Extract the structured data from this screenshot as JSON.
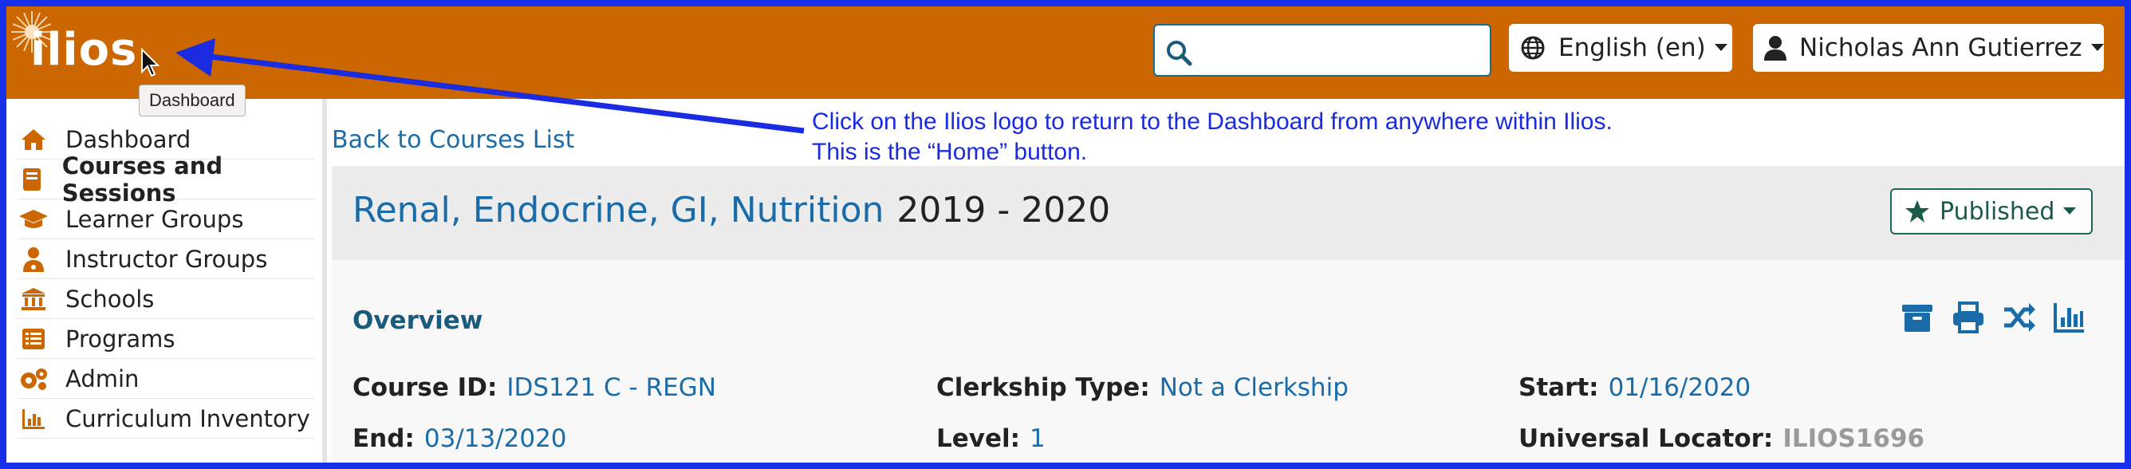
{
  "header": {
    "logo_text": "ilios",
    "tooltip": "Dashboard",
    "search": {
      "value": "",
      "placeholder": ""
    },
    "language": "English (en)",
    "user": "Nicholas Ann Gutierrez",
    "accent_color": "#cc6600"
  },
  "sidebar": {
    "items": [
      {
        "label": "Dashboard",
        "icon": "home-icon",
        "active": false
      },
      {
        "label": "Courses and Sessions",
        "icon": "book-icon",
        "active": true
      },
      {
        "label": "Learner Groups",
        "icon": "graduation-cap-icon",
        "active": false
      },
      {
        "label": "Instructor Groups",
        "icon": "user-md-icon",
        "active": false
      },
      {
        "label": "Schools",
        "icon": "university-icon",
        "active": false
      },
      {
        "label": "Programs",
        "icon": "list-alt-icon",
        "active": false
      },
      {
        "label": "Admin",
        "icon": "cogs-icon",
        "active": false
      },
      {
        "label": "Curriculum Inventory",
        "icon": "bar-chart-icon",
        "active": false
      }
    ]
  },
  "main": {
    "back_link": "Back to Courses List",
    "course_title": "Renal, Endocrine, GI, Nutrition",
    "course_year": "2019 - 2020",
    "status_button": "Published",
    "overview": {
      "title": "Overview",
      "tools": [
        "archive-icon",
        "print-icon",
        "shuffle-icon",
        "bar-chart-icon"
      ],
      "fields": {
        "course_id": {
          "label": "Course ID:",
          "value": "IDS121 C - REGN"
        },
        "clerkship": {
          "label": "Clerkship Type:",
          "value": "Not a Clerkship"
        },
        "start": {
          "label": "Start:",
          "value": "01/16/2020"
        },
        "end": {
          "label": "End:",
          "value": "03/13/2020"
        },
        "level": {
          "label": "Level:",
          "value": "1"
        },
        "locator": {
          "label": "Universal Locator:",
          "value": "ILIOS1696"
        }
      }
    }
  },
  "annotation": {
    "line1": "Click on the Ilios logo to return to the Dashboard from anywhere within Ilios.",
    "line2": "This is the “Home” button.",
    "color": "#1a2be0"
  }
}
